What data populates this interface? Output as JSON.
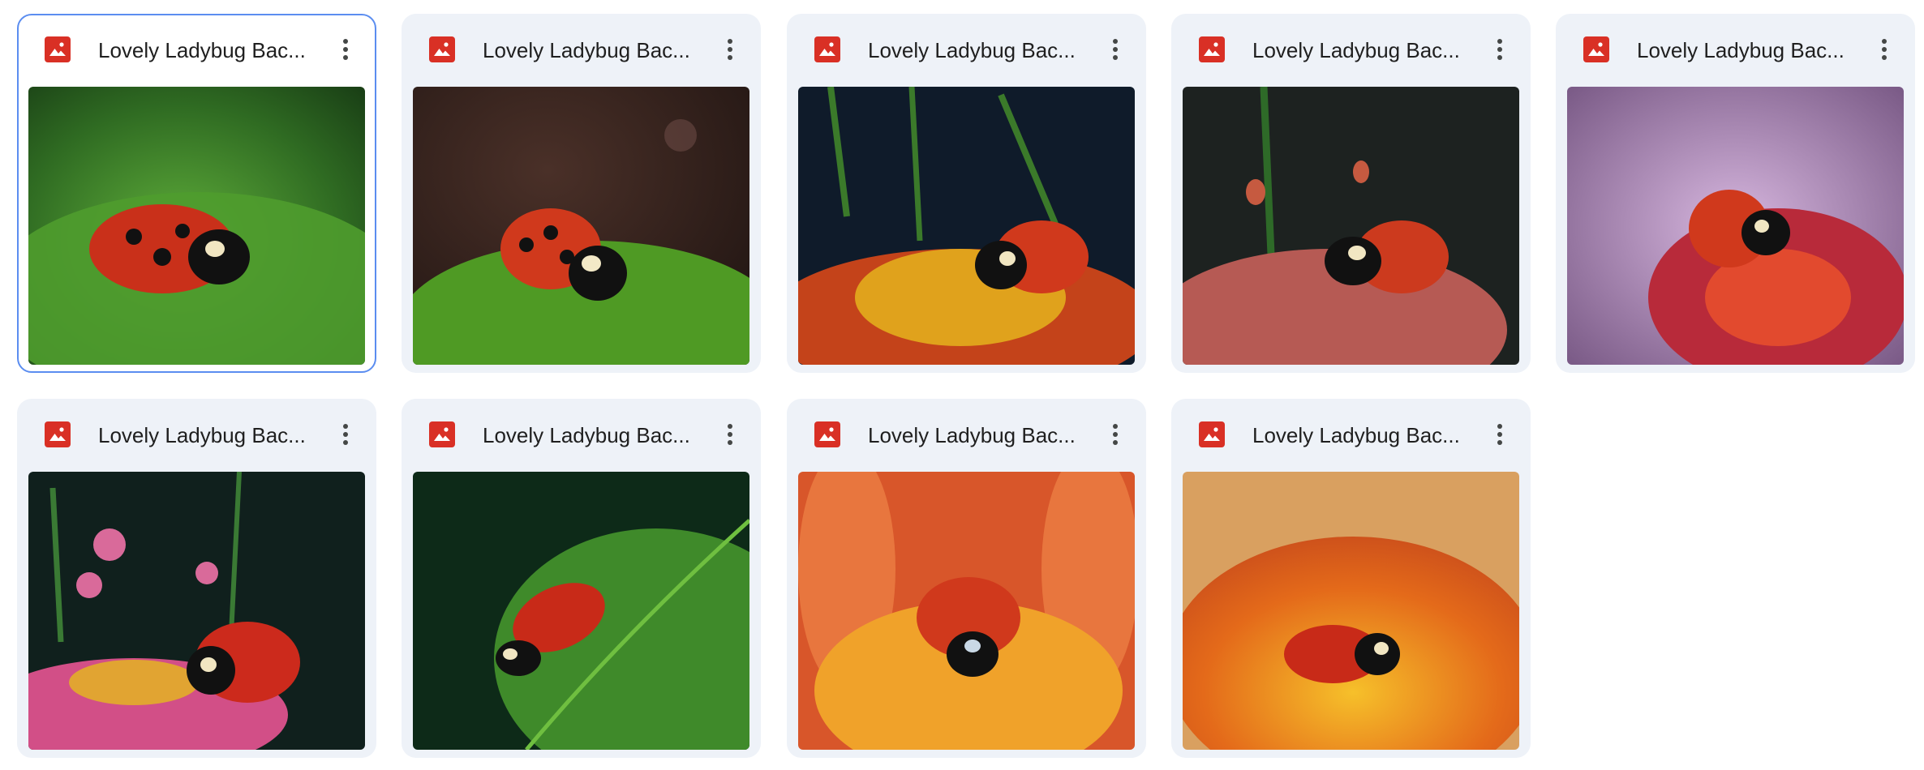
{
  "files": [
    {
      "name": "Lovely Ladybug Bac...",
      "selected": true
    },
    {
      "name": "Lovely Ladybug Bac...",
      "selected": false
    },
    {
      "name": "Lovely Ladybug Bac...",
      "selected": false
    },
    {
      "name": "Lovely Ladybug Bac...",
      "selected": false
    },
    {
      "name": "Lovely Ladybug Bac...",
      "selected": false
    },
    {
      "name": "Lovely Ladybug Bac...",
      "selected": false
    },
    {
      "name": "Lovely Ladybug Bac...",
      "selected": false
    },
    {
      "name": "Lovely Ladybug Bac...",
      "selected": false
    },
    {
      "name": "Lovely Ladybug Bac...",
      "selected": false
    }
  ],
  "colors": {
    "card_bg": "#eef2f8",
    "selected_border": "#5b8df0",
    "image_icon": "#d93025",
    "text": "#1f1f1f",
    "more_icon": "#444746"
  },
  "icons": {
    "file_type": "image-file-icon",
    "more": "more-vert-icon"
  }
}
